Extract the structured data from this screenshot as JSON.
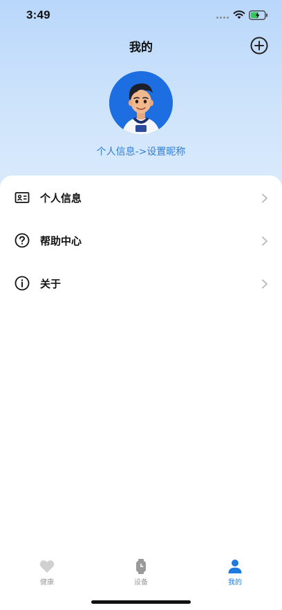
{
  "status_bar": {
    "time": "3:49"
  },
  "header": {
    "title": "我的",
    "add_icon": "plus-circle-icon"
  },
  "profile": {
    "nickname_hint": "个人信息->设置昵称"
  },
  "menu": {
    "items": [
      {
        "label": "个人信息",
        "icon": "id-card-icon"
      },
      {
        "label": "帮助中心",
        "icon": "help-circle-icon"
      },
      {
        "label": "关于",
        "icon": "info-circle-icon"
      }
    ]
  },
  "tab_bar": {
    "tabs": [
      {
        "label": "健康",
        "icon": "heart-icon",
        "active": false
      },
      {
        "label": "设备",
        "icon": "watch-icon",
        "active": false
      },
      {
        "label": "我的",
        "icon": "person-icon",
        "active": true
      }
    ]
  },
  "colors": {
    "accent": "#1f7ae0",
    "link": "#2d7fd8",
    "header_gradient_top": "#b9d7fb",
    "inactive_tab": "#9a9a9a"
  }
}
